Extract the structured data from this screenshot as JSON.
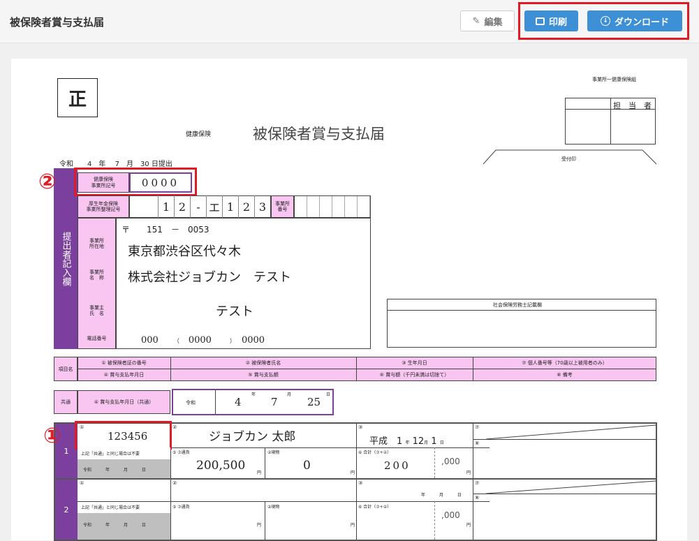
{
  "header": {
    "title": "被保険者賞与支払届",
    "edit_label": "編集",
    "print_label": "印刷",
    "download_label": "ダウンロード"
  },
  "form": {
    "sei_mark": "正",
    "top_right_note": "事業所一健康保険組",
    "tantou": "担　当　者",
    "kenko_hoken": "健康保険",
    "form_title": "被保険者賞与支払届",
    "uketsuke": "受付印",
    "teishutsu": {
      "era": "令和",
      "year": "4",
      "y": "年",
      "month": "7",
      "m": "月",
      "day": "30",
      "suffix": "日提出"
    },
    "office_code_label": "健康保険\n事業所記号",
    "office_code_value": "0000",
    "kosei_label": "厚生年金保険\n事業所整理記号",
    "kosei_digits": [
      "1",
      "2",
      "-",
      "エ",
      "1",
      "2",
      "3"
    ],
    "office_no_label": "事業所\n番号",
    "side_label": "提出者記入欄",
    "postal_mark": "〒",
    "postal_a": "151",
    "postal_dash": "－",
    "postal_b": "0053",
    "address_label": "事業所\n所在地",
    "address": "東京都渋谷区代々木",
    "name_label": "事業所\n名　称",
    "company_name": "株式会社ジョブカン　テスト",
    "owner_label": "事業主\n氏　名",
    "owner_name": "テスト",
    "phone_label": "電話番号",
    "phone_a": "000",
    "phone_p1": "（",
    "phone_b": "0000",
    "phone_p2": "）",
    "phone_c": "0000",
    "sharoushi_label": "社会保険労務士記載欄",
    "koumoku": "項目名",
    "col_headers_top": [
      "① 被保険者証の番号",
      "② 被保険者氏名",
      "③ 生年月日",
      "⑦ 個人番号等（70歳以上被用者のみ）"
    ],
    "col_headers_bottom": [
      "④ 賞与支払年月日",
      "⑤ 賞与支払額",
      "⑥ 賞与額（千円未満は切捨て）",
      "⑧ 備考"
    ],
    "kyoutsu": "共通",
    "kyoutsu_label": "④ 賞与支払年月日（共通）",
    "kyoutsu_era": "令和",
    "kyoutsu_year": "4",
    "kyoutsu_month": "7",
    "kyoutsu_day": "25",
    "ymd": [
      "年",
      "月",
      "日"
    ],
    "rows": [
      {
        "num": "1",
        "c1": "①",
        "insured_no": "123456",
        "c2": "②",
        "name": "ジョブカン 太郎",
        "c3": "③",
        "birth_era": "平成",
        "birth_y": "1",
        "birth_m": "12",
        "birth_d": "1",
        "c7": "⑦",
        "c8": "⑧",
        "same_note": "上記「共通」と同じ場合は不要",
        "era": "令和",
        "y": "年",
        "m": "月",
        "d": "日",
        "tsuka_label": "⑤ ⑦通貨",
        "tsuka": "200,500",
        "yen": "円",
        "genmotsu_label": "②現物",
        "genmotsu": "0",
        "total_label": "⑥ 合計（⑦+②）",
        "total": "200",
        "thousand": ",000"
      },
      {
        "num": "2",
        "c1": "①",
        "insured_no": "",
        "c2": "②",
        "name": "",
        "c3": "③",
        "birth_era": "",
        "birth_y": "",
        "birth_m": "",
        "birth_d": "",
        "c7": "⑦",
        "c8": "⑧",
        "same_note": "上記「共通」と同じ場合は不要",
        "era": "令和",
        "y": "年",
        "m": "月",
        "d": "日",
        "tsuka_label": "⑤ ⑦通貨",
        "tsuka": "",
        "yen": "円",
        "genmotsu_label": "②現物",
        "genmotsu": "",
        "total_label": "⑥ 合計（⑦+②）",
        "total": "",
        "thousand": ",000"
      }
    ]
  },
  "callouts": {
    "one": "①",
    "two": "②"
  },
  "colors": {
    "accent": "#3d8fd6",
    "highlight": "#e01b24",
    "purple": "#7b3f9e",
    "pink": "#f9c6f2"
  }
}
